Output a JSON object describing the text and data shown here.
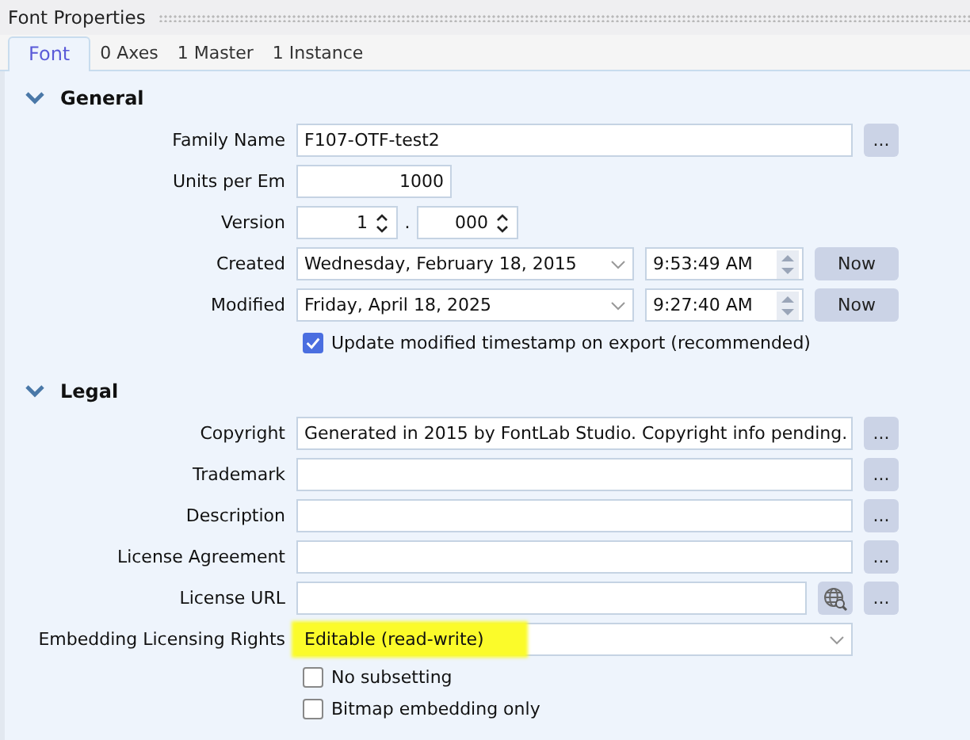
{
  "panel_title": "Font Properties",
  "tabs": [
    {
      "label": "Font",
      "selected": true
    },
    {
      "label": "0 Axes",
      "selected": false
    },
    {
      "label": "1 Master",
      "selected": false
    },
    {
      "label": "1 Instance",
      "selected": false
    }
  ],
  "sections": [
    {
      "title": "General",
      "expanded": true,
      "rows": [
        {
          "kind": "text",
          "label": "Family Name",
          "value": "F107-OTF-test2",
          "more": "..."
        },
        {
          "kind": "number",
          "label": "Units per Em",
          "value": "1000"
        },
        {
          "kind": "version",
          "label": "Version",
          "major": "1",
          "separator": ".",
          "minor": "000"
        },
        {
          "kind": "datetime",
          "label": "Created",
          "date": "Wednesday, February 18, 2015",
          "time": "9:53:49 AM",
          "button": "Now"
        },
        {
          "kind": "datetime",
          "label": "Modified",
          "date": "Friday, April 18, 2025",
          "time": "9:27:40 AM",
          "button": "Now"
        },
        {
          "kind": "checkbox",
          "label": "Update modified timestamp on export (recommended)",
          "checked": true
        }
      ]
    },
    {
      "title": "Legal",
      "expanded": true,
      "rows": [
        {
          "kind": "text",
          "label": "Copyright",
          "value": "Generated in 2015 by FontLab Studio. Copyright info pending.",
          "more": "..."
        },
        {
          "kind": "text",
          "label": "Trademark",
          "value": "",
          "more": "..."
        },
        {
          "kind": "text",
          "label": "Description",
          "value": "",
          "more": "..."
        },
        {
          "kind": "text",
          "label": "License Agreement",
          "value": "",
          "more": "..."
        },
        {
          "kind": "url",
          "label": "License URL",
          "value": "",
          "more": "..."
        },
        {
          "kind": "dropdown",
          "label": "Embedding Licensing Rights",
          "value": "Editable (read-write)",
          "highlighted": true
        },
        {
          "kind": "checkbox",
          "label": "No subsetting",
          "checked": false
        },
        {
          "kind": "checkbox",
          "label": "Bitmap embedding only",
          "checked": false
        }
      ]
    }
  ]
}
